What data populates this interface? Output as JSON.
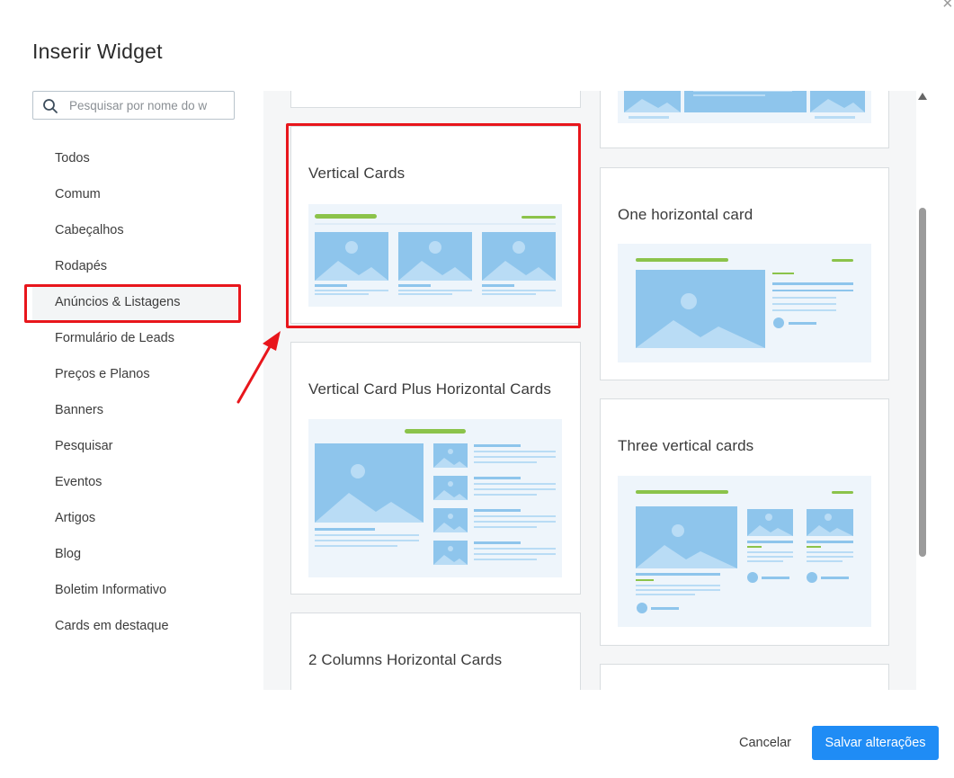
{
  "dialog": {
    "title": "Inserir Widget",
    "close_icon": "close-icon",
    "close_glyph": "×"
  },
  "search": {
    "placeholder": "Pesquisar por nome do w",
    "value": "",
    "icon": "search-icon"
  },
  "categories": {
    "selected": "Anúncios & Listagens",
    "items": [
      {
        "label": "Todos"
      },
      {
        "label": "Comum"
      },
      {
        "label": "Cabeçalhos"
      },
      {
        "label": "Rodapés"
      },
      {
        "label": "Anúncios & Listagens"
      },
      {
        "label": "Formulário de Leads"
      },
      {
        "label": "Preços e Planos"
      },
      {
        "label": "Banners"
      },
      {
        "label": "Pesquisar"
      },
      {
        "label": "Eventos"
      },
      {
        "label": "Artigos"
      },
      {
        "label": "Blog"
      },
      {
        "label": "Boletim Informativo"
      },
      {
        "label": "Cards em destaque"
      }
    ]
  },
  "widgets": {
    "vertical_cards": {
      "title": "Vertical Cards"
    },
    "vertical_plus_horizontal": {
      "title": "Vertical Card Plus Horizontal Cards"
    },
    "two_columns_horizontal": {
      "title": "2 Columns Horizontal Cards"
    },
    "one_horizontal": {
      "title": "One horizontal card"
    },
    "three_vertical": {
      "title": "Three vertical cards"
    }
  },
  "footer": {
    "cancel_label": "Cancelar",
    "save_label": "Salvar alterações"
  },
  "colors": {
    "primary": "#1f8cf5",
    "annotation": "#e8161c",
    "preview_green": "#8bc34a",
    "preview_blue": "#8ec5ec",
    "preview_light": "#eef5fb"
  }
}
